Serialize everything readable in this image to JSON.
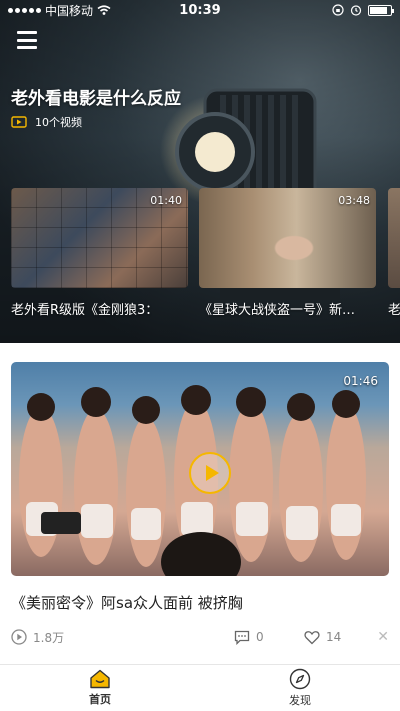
{
  "status_bar": {
    "carrier": "中国移动",
    "time": "10:39",
    "battery_level": 0.85
  },
  "header": {
    "menu_icon": "hamburger-menu-icon",
    "title": "老外看电影是什么反应",
    "video_count": "10个视频",
    "video_icon": "video-icon"
  },
  "thumbnails": [
    {
      "duration": "01:40",
      "caption": "老外看R级版《金刚狼3："
    },
    {
      "duration": "03:48",
      "caption": "《星球大战侠盗一号》新…"
    },
    {
      "duration": "",
      "caption": "老"
    }
  ],
  "feed": {
    "duration": "01:46",
    "title": "《美丽密令》阿sa众人面前 被挤胸",
    "plays": "1.8万",
    "comments": "0",
    "likes": "14"
  },
  "tabs": [
    {
      "label": "首页",
      "icon": "home-icon",
      "active": true
    },
    {
      "label": "发现",
      "icon": "compass-icon",
      "active": false
    }
  ],
  "colors": {
    "accent": "#f5b700",
    "text_gray": "#888888"
  }
}
